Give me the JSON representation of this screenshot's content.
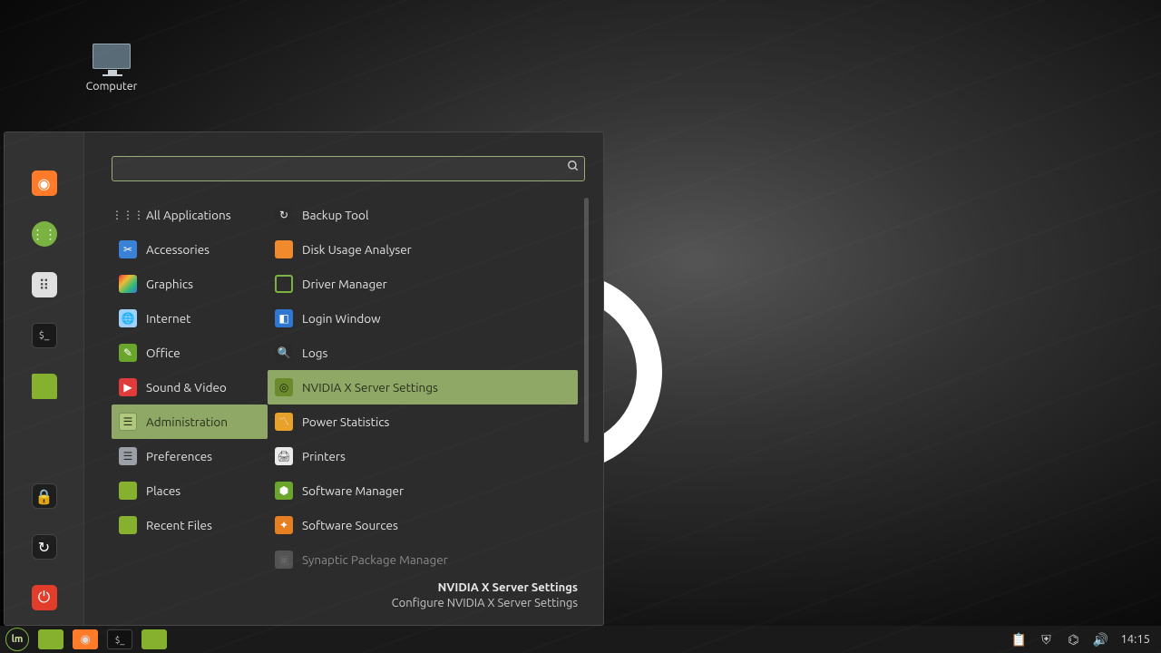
{
  "desktop": {
    "icons": [
      {
        "label": "Computer"
      }
    ]
  },
  "menu": {
    "search": {
      "value": "",
      "placeholder": ""
    },
    "favorites": [
      {
        "id": "firefox"
      },
      {
        "id": "applications"
      },
      {
        "id": "settings"
      },
      {
        "id": "terminal"
      },
      {
        "id": "files"
      }
    ],
    "session": [
      {
        "id": "lock"
      },
      {
        "id": "logout"
      },
      {
        "id": "shutdown"
      }
    ],
    "categories": [
      {
        "label": "All Applications",
        "icon": "grid"
      },
      {
        "label": "Accessories",
        "icon": "blue"
      },
      {
        "label": "Graphics",
        "icon": "rainbow"
      },
      {
        "label": "Internet",
        "icon": "globe"
      },
      {
        "label": "Office",
        "icon": "office"
      },
      {
        "label": "Sound & Video",
        "icon": "play"
      },
      {
        "label": "Administration",
        "icon": "admin",
        "selected": true
      },
      {
        "label": "Preferences",
        "icon": "prefs"
      },
      {
        "label": "Places",
        "icon": "folder"
      },
      {
        "label": "Recent Files",
        "icon": "folder"
      }
    ],
    "apps": [
      {
        "label": "Backup Tool",
        "icon": "backup"
      },
      {
        "label": "Disk Usage Analyser",
        "icon": "disk"
      },
      {
        "label": "Driver Manager",
        "icon": "square"
      },
      {
        "label": "Login Window",
        "icon": "login"
      },
      {
        "label": "Logs",
        "icon": "search"
      },
      {
        "label": "NVIDIA X Server Settings",
        "icon": "nvidia",
        "selected": true
      },
      {
        "label": "Power Statistics",
        "icon": "pulse"
      },
      {
        "label": "Printers",
        "icon": "printer"
      },
      {
        "label": "Software Manager",
        "icon": "soft"
      },
      {
        "label": "Software Sources",
        "icon": "src"
      },
      {
        "label": "Synaptic Package Manager",
        "icon": "synaptic",
        "dim": true
      }
    ],
    "description": {
      "title": "NVIDIA X Server Settings",
      "sub": "Configure NVIDIA X Server Settings"
    }
  },
  "panel": {
    "launchers": [
      {
        "id": "files"
      },
      {
        "id": "firefox"
      },
      {
        "id": "terminal"
      },
      {
        "id": "files2"
      }
    ],
    "clock": "14:15"
  }
}
